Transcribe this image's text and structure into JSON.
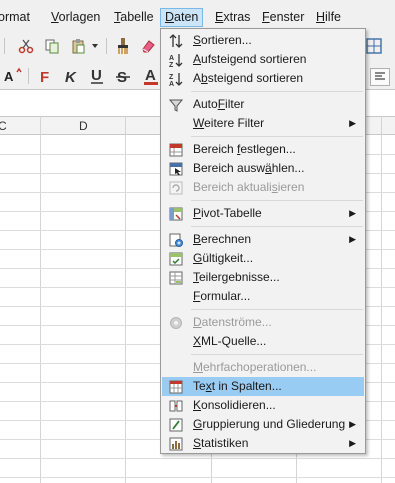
{
  "menubar": {
    "items": [
      {
        "label": "ormat",
        "ul": ""
      },
      {
        "label": "Vorlagen",
        "ul": "V"
      },
      {
        "label": "Tabelle",
        "ul": "T"
      },
      {
        "label": "Daten",
        "ul": "D"
      },
      {
        "label": "Extras",
        "ul": "E"
      },
      {
        "label": "Fenster",
        "ul": "F"
      },
      {
        "label": "Hilfe",
        "ul": "H"
      }
    ]
  },
  "columns": {
    "c": "C",
    "d": "D"
  },
  "menu": {
    "items": [
      {
        "pre": "",
        "ul": "S",
        "post": "ortieren...",
        "icon": "sort-icon",
        "disabled": false,
        "submenu": false
      },
      {
        "pre": "",
        "ul": "A",
        "post": "ufsteigend sortieren",
        "icon": "sort-ascending-icon",
        "disabled": false,
        "submenu": false
      },
      {
        "pre": "A",
        "ul": "b",
        "post": "steigend sortieren",
        "icon": "sort-descending-icon",
        "disabled": false,
        "submenu": false
      },
      {
        "pre": "Auto",
        "ul": "F",
        "post": "ilter",
        "icon": "autofilter-icon",
        "disabled": false,
        "submenu": false
      },
      {
        "pre": "",
        "ul": "W",
        "post": "eitere Filter",
        "icon": "",
        "disabled": false,
        "submenu": true
      },
      {
        "pre": "Bereich ",
        "ul": "f",
        "post": "estlegen...",
        "icon": "define-range-icon",
        "disabled": false,
        "submenu": false
      },
      {
        "pre": "Bereich ausw",
        "ul": "ä",
        "post": "hlen...",
        "icon": "select-range-icon",
        "disabled": false,
        "submenu": false
      },
      {
        "pre": "Bereich aktuali",
        "ul": "s",
        "post": "ieren",
        "icon": "refresh-range-icon",
        "disabled": true,
        "submenu": false
      },
      {
        "pre": "",
        "ul": "P",
        "post": "ivot-Tabelle",
        "icon": "pivot-table-icon",
        "disabled": false,
        "submenu": true
      },
      {
        "pre": "",
        "ul": "B",
        "post": "erechnen",
        "icon": "calculate-icon",
        "disabled": false,
        "submenu": true
      },
      {
        "pre": "",
        "ul": "G",
        "post": "ültigkeit...",
        "icon": "validity-icon",
        "disabled": false,
        "submenu": false
      },
      {
        "pre": "",
        "ul": "T",
        "post": "eilergebnisse...",
        "icon": "subtotals-icon",
        "disabled": false,
        "submenu": false
      },
      {
        "pre": "",
        "ul": "F",
        "post": "ormular...",
        "icon": "",
        "disabled": false,
        "submenu": false
      },
      {
        "pre": "",
        "ul": "D",
        "post": "atenströme...",
        "icon": "streams-icon",
        "disabled": true,
        "submenu": false
      },
      {
        "pre": "",
        "ul": "X",
        "post": "ML-Quelle...",
        "icon": "",
        "disabled": false,
        "submenu": false
      },
      {
        "pre": "",
        "ul": "M",
        "post": "ehrfachoperationen...",
        "icon": "",
        "disabled": true,
        "submenu": false
      },
      {
        "pre": "Te",
        "ul": "x",
        "post": "t in Spalten...",
        "icon": "text-to-columns-icon",
        "disabled": false,
        "submenu": false
      },
      {
        "pre": "",
        "ul": "K",
        "post": "onsolidieren...",
        "icon": "consolidate-icon",
        "disabled": false,
        "submenu": false
      },
      {
        "pre": "",
        "ul": "G",
        "post": "ruppierung und Gliederung",
        "icon": "group-outline-icon",
        "disabled": false,
        "submenu": true
      },
      {
        "pre": "",
        "ul": "S",
        "post": "tatistiken",
        "icon": "statistics-icon",
        "disabled": false,
        "submenu": true
      }
    ]
  },
  "colors": {
    "highlight": "#99ccf3",
    "active_menu": "#cce4f7",
    "accent_red": "#c0392b"
  }
}
